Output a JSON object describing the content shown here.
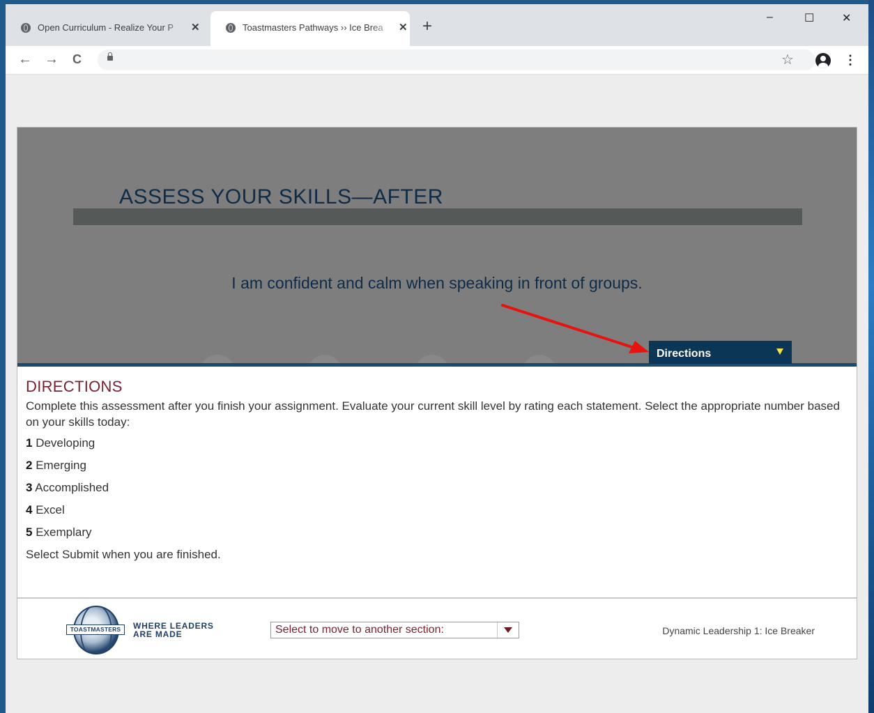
{
  "browser": {
    "tabs": [
      {
        "title": "Open Curriculum - Realize Your P",
        "active": false
      },
      {
        "title": "Toastmasters Pathways ›› Ice Brea",
        "active": true
      }
    ],
    "new_tab_label": "+",
    "window_controls": {
      "minimize": "–",
      "maximize": "☐",
      "close": "✕"
    },
    "nav": {
      "back": "←",
      "forward": "→",
      "reload": "C"
    },
    "url": "",
    "icons": [
      "globe-icon",
      "close-icon",
      "lock-icon",
      "star-icon",
      "account-icon",
      "menu-icon"
    ]
  },
  "page": {
    "hero": {
      "title": "ASSESS YOUR SKILLS—AFTER",
      "statement": "I am confident and calm when speaking in front of groups."
    },
    "directions_tab": {
      "label": "Directions",
      "accent": "#f2e24c"
    },
    "directions": {
      "heading": "DIRECTIONS",
      "intro": "Complete this assessment after you finish your assignment. Evaluate your current skill level by rating each statement. Select the appropriate number based on your skills today:",
      "scale": [
        {
          "num": "1",
          "label": " Developing"
        },
        {
          "num": "2",
          "label": " Emerging"
        },
        {
          "num": "3",
          "label": " Accomplished"
        },
        {
          "num": "4",
          "label": " Excel"
        },
        {
          "num": "5",
          "label": " Exemplary"
        }
      ],
      "closing": "Select Submit when you are finished."
    },
    "footer": {
      "logo_banner": "TOASTMASTERS",
      "logo_tagline_1": "WHERE LEADERS",
      "logo_tagline_2": "ARE MADE",
      "section_select_placeholder": "Select to move to another section:",
      "module_name": "Dynamic Leadership 1: Ice Breaker"
    }
  },
  "colors": {
    "hero_bg": "#7e7e7e",
    "navy": "#0b3656",
    "heading_maroon": "#7a1f2e",
    "annotation_arrow": "#e8120e"
  }
}
